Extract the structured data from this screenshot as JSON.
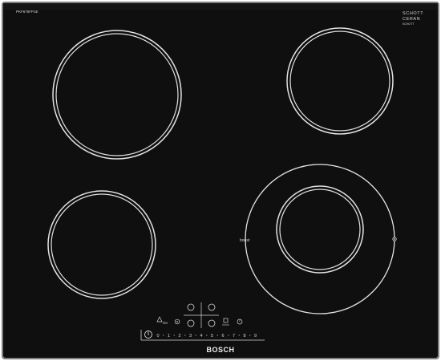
{
  "product": {
    "model": "PKF675FP1E",
    "logo": "BOSCH",
    "glass_brand_line1": "SCHOTT",
    "glass_brand_line2": "CERAN",
    "glass_small_text": "SCHOTT"
  },
  "zones": [
    {
      "name": "front-left"
    },
    {
      "name": "rear-left"
    },
    {
      "name": "rear-right"
    },
    {
      "name": "front-right-dual",
      "label_left": "boost"
    }
  ],
  "controls": {
    "power_icon": "power-icon",
    "on_label": "On",
    "lock_icon": "lock-icon",
    "timer_icon": "timer-icon",
    "wipe_icon": "wipe-protect-icon",
    "slider_values": [
      "0",
      "1",
      "2",
      "3",
      "4",
      "5",
      "6",
      "7",
      "8",
      "9"
    ]
  },
  "colors": {
    "glass": "#0f0f10",
    "frame": "#8a8a8a",
    "ring": "#e2e2e2",
    "print": "#d8d8d8"
  }
}
